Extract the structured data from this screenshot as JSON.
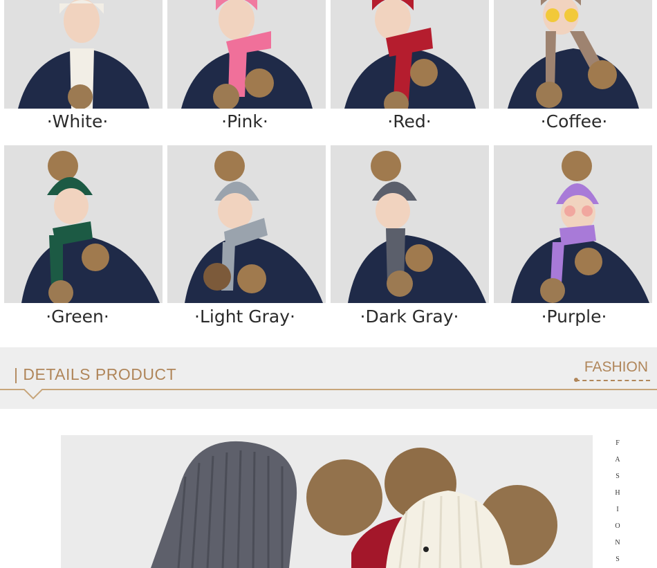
{
  "colors": {
    "accent_gold": "#b0865a",
    "band_bg": "#eeeeee"
  },
  "swatches": [
    {
      "label": "·White·",
      "hat": "#f2eee6",
      "scarf": "#f2eee6"
    },
    {
      "label": "·Pink·",
      "hat": "#f07aa0",
      "scarf": "#f0709a"
    },
    {
      "label": "·Red·",
      "hat": "#b51d2e",
      "scarf": "#b51d2e"
    },
    {
      "label": "·Coffee·",
      "hat": "#9e8370",
      "scarf": "#9e8370"
    },
    {
      "label": "·Green·",
      "hat": "#1c5a44",
      "scarf": "#1c5a44"
    },
    {
      "label": "·Light Gray·",
      "hat": "#9aa3ad",
      "scarf": "#9aa3ad"
    },
    {
      "label": "·Dark Gray·",
      "hat": "#5b5f6b",
      "scarf": "#5b5f6b"
    },
    {
      "label": "·Purple·",
      "hat": "#a87ad8",
      "scarf": "#a87ad8"
    }
  ],
  "details": {
    "title": "| DETAILS PRODUCT",
    "fashion": "FASHION"
  },
  "side_letters": [
    "F",
    "A",
    "S",
    "H",
    "I",
    "O",
    "N",
    "S"
  ]
}
